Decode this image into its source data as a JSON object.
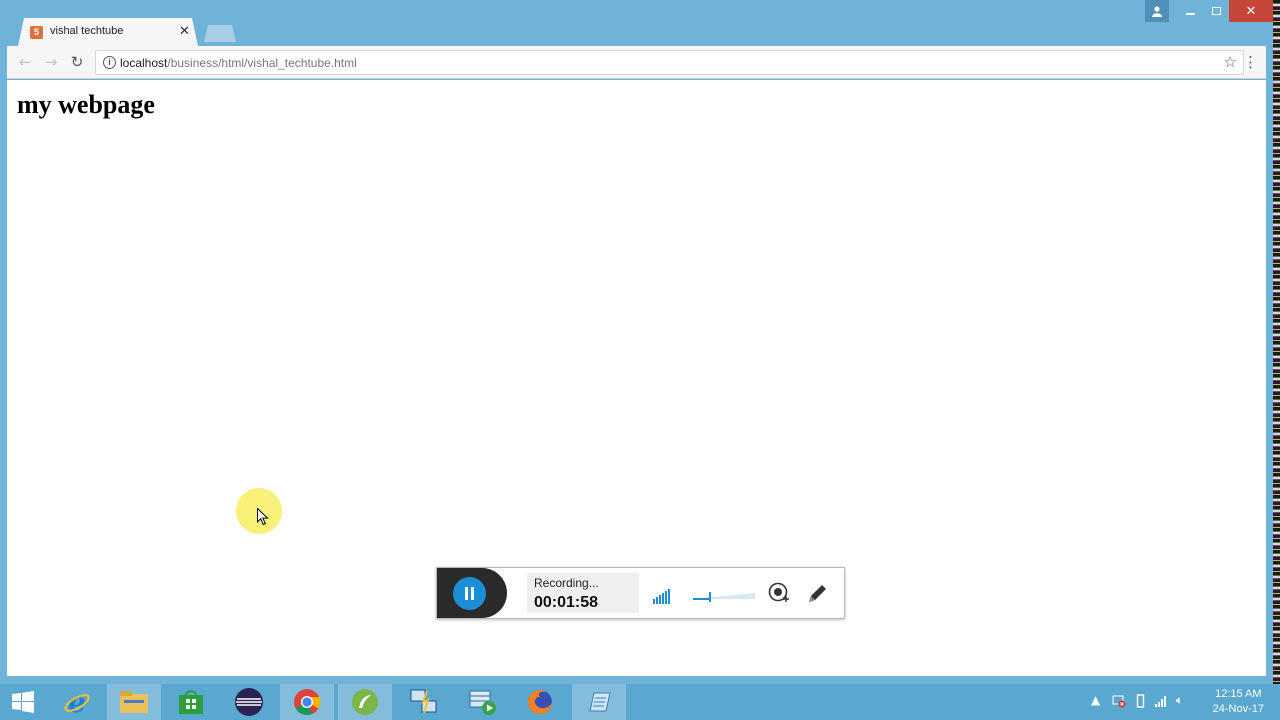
{
  "browser": {
    "tab": {
      "title": "vishal techtube",
      "favicon": "html-favicon-icon"
    },
    "address_bar": {
      "host": "localhost",
      "path": "/business/html/vishal_techtube.html"
    }
  },
  "page": {
    "heading": "my webpage"
  },
  "recorder": {
    "status": "Recording...",
    "elapsed": "00:01:58",
    "volume_level": 0.25
  },
  "taskbar": {
    "apps": [
      "windows-start-icon",
      "internet-explorer-icon",
      "file-explorer-icon",
      "store-icon",
      "eclipse-icon",
      "chrome-icon",
      "app-green-icon",
      "network-tool-icon",
      "media-app-icon",
      "firefox-icon",
      "notepad-icon"
    ],
    "clock": {
      "time": "12:15 AM",
      "date": "24-Nov-17"
    }
  },
  "colors": {
    "taskbar": "#5aa7cf",
    "chrome_frame": "#6fb3d9",
    "accent_blue": "#1a8fd8",
    "close_red": "#c7463a"
  }
}
